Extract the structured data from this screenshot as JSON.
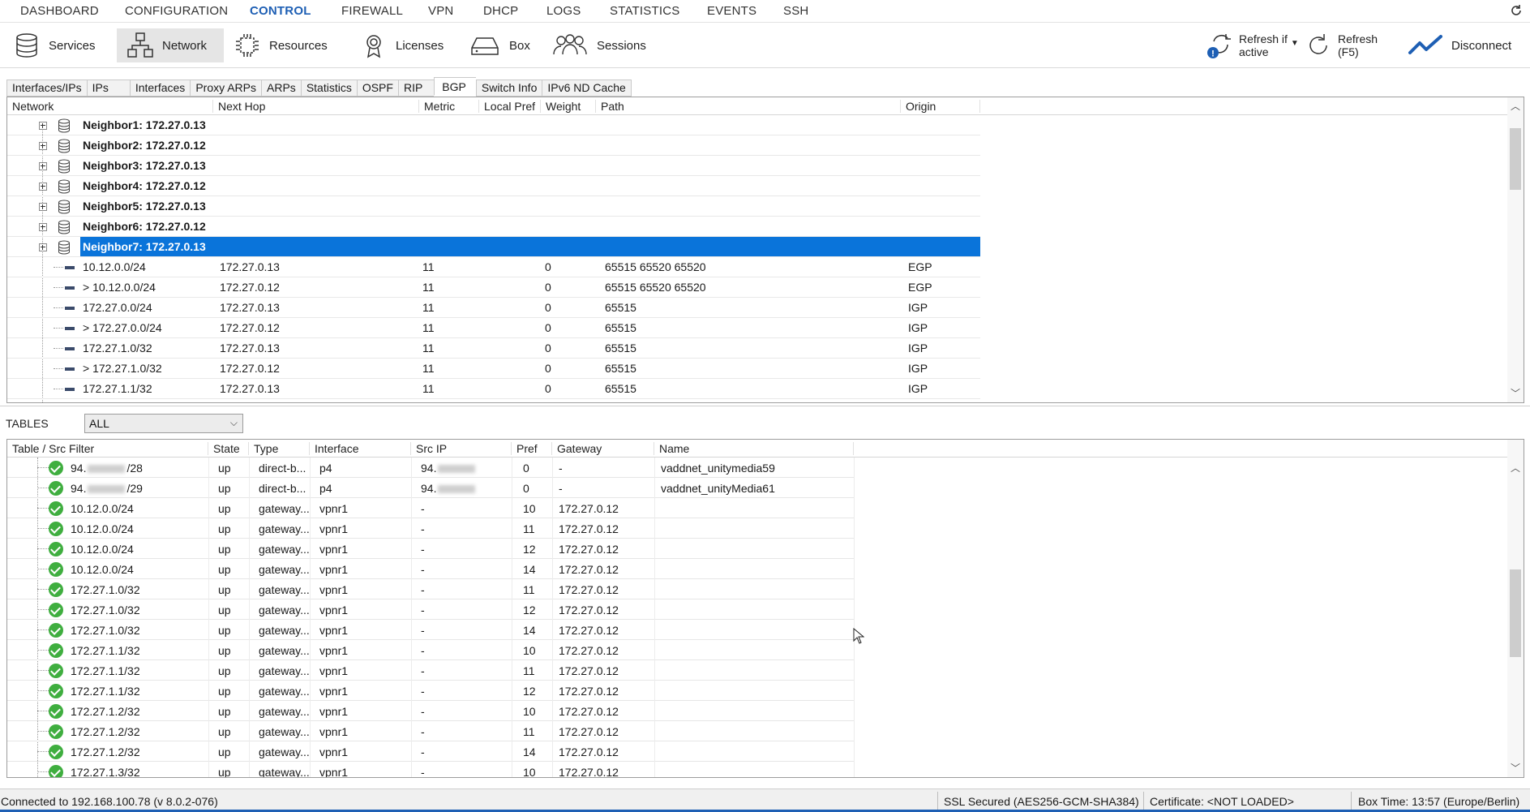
{
  "topnav": {
    "items": [
      {
        "label": "DASHBOARD",
        "active": false
      },
      {
        "label": "CONFIGURATION",
        "active": false
      },
      {
        "label": "CONTROL",
        "active": true
      },
      {
        "label": "FIREWALL",
        "active": false
      },
      {
        "label": "VPN",
        "active": false
      },
      {
        "label": "DHCP",
        "active": false
      },
      {
        "label": "LOGS",
        "active": false
      },
      {
        "label": "STATISTICS",
        "active": false
      },
      {
        "label": "EVENTS",
        "active": false
      },
      {
        "label": "SSH",
        "active": false
      }
    ]
  },
  "toolbar": {
    "services": "Services",
    "network": "Network",
    "resources": "Resources",
    "licenses": "Licenses",
    "box": "Box",
    "sessions": "Sessions",
    "refresh_if_active_1": "Refresh if",
    "refresh_if_active_2": "active",
    "refresh_1": "Refresh",
    "refresh_2": "(F5)",
    "disconnect": "Disconnect"
  },
  "subtabs": [
    "Interfaces/IPs",
    "IPs",
    "Interfaces",
    "Proxy ARPs",
    "ARPs",
    "Statistics",
    "OSPF",
    "RIP",
    "BGP",
    "Switch Info",
    "IPv6 ND Cache"
  ],
  "active_subtab": "BGP",
  "bgp": {
    "columns": [
      "Network",
      "Next Hop",
      "Metric",
      "Local Pref",
      "Weight",
      "Path",
      "Origin"
    ],
    "neighbors": [
      "Neighbor1: 172.27.0.13",
      "Neighbor2: 172.27.0.12",
      "Neighbor3: 172.27.0.13",
      "Neighbor4: 172.27.0.12",
      "Neighbor5: 172.27.0.13",
      "Neighbor6: 172.27.0.12",
      "Neighbor7: 172.27.0.13"
    ],
    "selected_neighbor": "Neighbor7: 172.27.0.13",
    "routes": [
      {
        "network": "10.12.0.0/24",
        "next_hop": "172.27.0.13",
        "metric": "11",
        "local_pref": "",
        "weight": "0",
        "path": "65515 65520 65520",
        "origin": "EGP"
      },
      {
        "network": "> 10.12.0.0/24",
        "next_hop": "172.27.0.12",
        "metric": "11",
        "local_pref": "",
        "weight": "0",
        "path": "65515 65520 65520",
        "origin": "EGP"
      },
      {
        "network": "172.27.0.0/24",
        "next_hop": "172.27.0.13",
        "metric": "11",
        "local_pref": "",
        "weight": "0",
        "path": "65515",
        "origin": "IGP"
      },
      {
        "network": "> 172.27.0.0/24",
        "next_hop": "172.27.0.12",
        "metric": "11",
        "local_pref": "",
        "weight": "0",
        "path": "65515",
        "origin": "IGP"
      },
      {
        "network": "172.27.1.0/32",
        "next_hop": "172.27.0.13",
        "metric": "11",
        "local_pref": "",
        "weight": "0",
        "path": "65515",
        "origin": "IGP"
      },
      {
        "network": "> 172.27.1.0/32",
        "next_hop": "172.27.0.12",
        "metric": "11",
        "local_pref": "",
        "weight": "0",
        "path": "65515",
        "origin": "IGP"
      },
      {
        "network": "172.27.1.1/32",
        "next_hop": "172.27.0.13",
        "metric": "11",
        "local_pref": "",
        "weight": "0",
        "path": "65515",
        "origin": "IGP"
      }
    ]
  },
  "tables": {
    "label": "TABLES",
    "selected": "ALL",
    "columns": [
      "Table / Src Filter",
      "State",
      "Type",
      "Interface",
      "Src IP",
      "Pref",
      "Gateway",
      "Name"
    ],
    "rows": [
      {
        "filter_prefix": "94.",
        "filter_suffix": "/28",
        "state": "up",
        "type": "direct-b...",
        "interface": "p4",
        "src_ip": "94.",
        "pref": "0",
        "gateway": "-",
        "name": "vaddnet_unitymedia59"
      },
      {
        "filter_prefix": "94.",
        "filter_suffix": "/29",
        "state": "up",
        "type": "direct-b...",
        "interface": "p4",
        "src_ip": "94.",
        "pref": "0",
        "gateway": "-",
        "name": "vaddnet_unityMedia61"
      },
      {
        "filter_prefix": "10.12.0.0/24",
        "filter_suffix": "",
        "state": "up",
        "type": "gateway...",
        "interface": "vpnr1",
        "src_ip": "-",
        "pref": "10",
        "gateway": "172.27.0.12",
        "name": ""
      },
      {
        "filter_prefix": "10.12.0.0/24",
        "filter_suffix": "",
        "state": "up",
        "type": "gateway...",
        "interface": "vpnr1",
        "src_ip": "-",
        "pref": "11",
        "gateway": "172.27.0.12",
        "name": ""
      },
      {
        "filter_prefix": "10.12.0.0/24",
        "filter_suffix": "",
        "state": "up",
        "type": "gateway...",
        "interface": "vpnr1",
        "src_ip": "-",
        "pref": "12",
        "gateway": "172.27.0.12",
        "name": ""
      },
      {
        "filter_prefix": "10.12.0.0/24",
        "filter_suffix": "",
        "state": "up",
        "type": "gateway...",
        "interface": "vpnr1",
        "src_ip": "-",
        "pref": "14",
        "gateway": "172.27.0.12",
        "name": ""
      },
      {
        "filter_prefix": "172.27.1.0/32",
        "filter_suffix": "",
        "state": "up",
        "type": "gateway...",
        "interface": "vpnr1",
        "src_ip": "-",
        "pref": "11",
        "gateway": "172.27.0.12",
        "name": ""
      },
      {
        "filter_prefix": "172.27.1.0/32",
        "filter_suffix": "",
        "state": "up",
        "type": "gateway...",
        "interface": "vpnr1",
        "src_ip": "-",
        "pref": "12",
        "gateway": "172.27.0.12",
        "name": ""
      },
      {
        "filter_prefix": "172.27.1.0/32",
        "filter_suffix": "",
        "state": "up",
        "type": "gateway...",
        "interface": "vpnr1",
        "src_ip": "-",
        "pref": "14",
        "gateway": "172.27.0.12",
        "name": ""
      },
      {
        "filter_prefix": "172.27.1.1/32",
        "filter_suffix": "",
        "state": "up",
        "type": "gateway...",
        "interface": "vpnr1",
        "src_ip": "-",
        "pref": "10",
        "gateway": "172.27.0.12",
        "name": ""
      },
      {
        "filter_prefix": "172.27.1.1/32",
        "filter_suffix": "",
        "state": "up",
        "type": "gateway...",
        "interface": "vpnr1",
        "src_ip": "-",
        "pref": "11",
        "gateway": "172.27.0.12",
        "name": ""
      },
      {
        "filter_prefix": "172.27.1.1/32",
        "filter_suffix": "",
        "state": "up",
        "type": "gateway...",
        "interface": "vpnr1",
        "src_ip": "-",
        "pref": "12",
        "gateway": "172.27.0.12",
        "name": ""
      },
      {
        "filter_prefix": "172.27.1.2/32",
        "filter_suffix": "",
        "state": "up",
        "type": "gateway...",
        "interface": "vpnr1",
        "src_ip": "-",
        "pref": "10",
        "gateway": "172.27.0.12",
        "name": ""
      },
      {
        "filter_prefix": "172.27.1.2/32",
        "filter_suffix": "",
        "state": "up",
        "type": "gateway...",
        "interface": "vpnr1",
        "src_ip": "-",
        "pref": "11",
        "gateway": "172.27.0.12",
        "name": ""
      },
      {
        "filter_prefix": "172.27.1.2/32",
        "filter_suffix": "",
        "state": "up",
        "type": "gateway...",
        "interface": "vpnr1",
        "src_ip": "-",
        "pref": "14",
        "gateway": "172.27.0.12",
        "name": ""
      },
      {
        "filter_prefix": "172.27.1.3/32",
        "filter_suffix": "",
        "state": "up",
        "type": "gateway...",
        "interface": "vpnr1",
        "src_ip": "-",
        "pref": "10",
        "gateway": "172.27.0.12",
        "name": ""
      }
    ]
  },
  "statusbar": {
    "connected": "Connected to 192.168.100.78 (v 8.0.2-076)",
    "ssl": "SSL Secured (AES256-GCM-SHA384)",
    "certificate": "Certificate: <NOT LOADED>",
    "box_time": "Box Time: 13:57 (Europe/Berlin)"
  },
  "colors": {
    "accent": "#1e5fb4",
    "selection": "#0a74da",
    "status_ok": "#3fae3f"
  }
}
